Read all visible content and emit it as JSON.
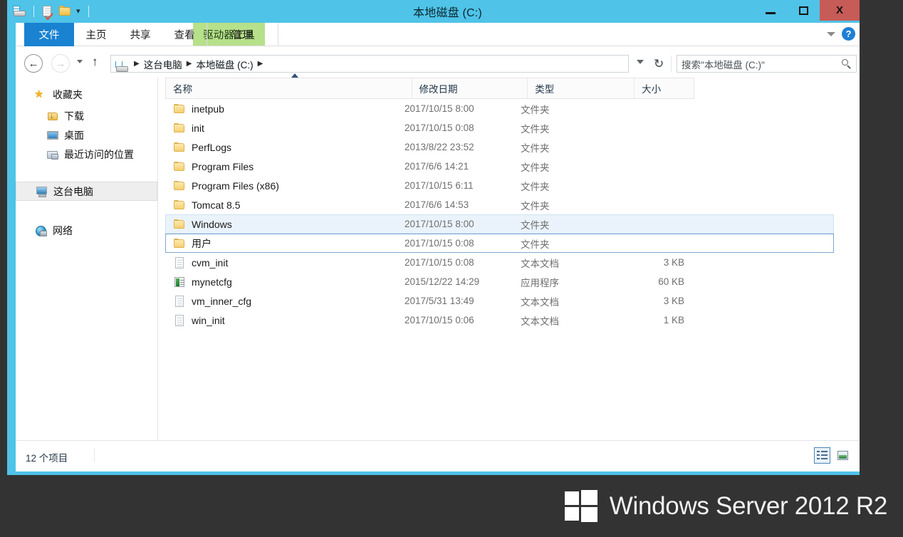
{
  "window": {
    "title": "本地磁盘 (C:)",
    "accent_color": "#4fc3e8",
    "close_color": "#c75b57",
    "quick_access": [
      {
        "name": "drive-icon",
        "label": "本地磁盘 (C:)"
      },
      {
        "name": "properties-icon",
        "label": "属性"
      },
      {
        "name": "new-folder-icon",
        "label": "新建文件夹"
      },
      {
        "name": "customize-qat-caret",
        "label": "▼"
      }
    ],
    "controls": {
      "minimize": "—",
      "maximize": "▢",
      "close": "X"
    }
  },
  "ribbon": {
    "contextual_tab_header": "驱动器工具",
    "contextual_color": "#b6e08a",
    "active_tab_color": "#1982d1",
    "tabs": [
      {
        "label": "文件",
        "active": true
      },
      {
        "label": "主页",
        "active": false
      },
      {
        "label": "共享",
        "active": false
      },
      {
        "label": "查看",
        "active": false
      },
      {
        "label": "管理",
        "active": false,
        "contextual": true
      }
    ],
    "minimize_ribbon_icon": "chevron-down-icon",
    "help_label": "?"
  },
  "navigation": {
    "back_label": "←",
    "forward_label": "→",
    "recent_caret": "▾",
    "up_label": "↑",
    "breadcrumb": [
      {
        "label": "这台电脑"
      },
      {
        "label": "本地磁盘 (C:)"
      }
    ],
    "breadcrumb_separator": "▶",
    "address_dropdown": "▾",
    "refresh_label": "↻"
  },
  "search": {
    "placeholder": "搜索\"本地磁盘 (C:)\"",
    "value": "",
    "icon": "search-icon"
  },
  "sidebar": {
    "items": [
      {
        "label": "收藏夹",
        "icon": "star-icon",
        "level": 0,
        "selected": false
      },
      {
        "label": "下载",
        "icon": "downloads-folder-icon",
        "level": 1,
        "selected": false
      },
      {
        "label": "桌面",
        "icon": "desktop-icon",
        "level": 1,
        "selected": false
      },
      {
        "label": "最近访问的位置",
        "icon": "recent-places-icon",
        "level": 1,
        "selected": false
      },
      {
        "label": "这台电脑",
        "icon": "this-pc-icon",
        "level": 0,
        "selected": true
      },
      {
        "label": "网络",
        "icon": "network-icon",
        "level": 0,
        "selected": false
      }
    ]
  },
  "filelist": {
    "columns": [
      {
        "label": "名称",
        "key": "name",
        "sorted": "asc"
      },
      {
        "label": "修改日期",
        "key": "date"
      },
      {
        "label": "类型",
        "key": "type"
      },
      {
        "label": "大小",
        "key": "size"
      }
    ],
    "sort_indicator": "▲",
    "rows": [
      {
        "name": "inetpub",
        "date": "2017/10/15 8:00",
        "type": "文件夹",
        "size": "",
        "icon": "folder-icon",
        "state": ""
      },
      {
        "name": "init",
        "date": "2017/10/15 0:08",
        "type": "文件夹",
        "size": "",
        "icon": "folder-icon",
        "state": ""
      },
      {
        "name": "PerfLogs",
        "date": "2013/8/22 23:52",
        "type": "文件夹",
        "size": "",
        "icon": "folder-icon",
        "state": ""
      },
      {
        "name": "Program Files",
        "date": "2017/6/6 14:21",
        "type": "文件夹",
        "size": "",
        "icon": "folder-icon",
        "state": ""
      },
      {
        "name": "Program Files (x86)",
        "date": "2017/10/15 6:11",
        "type": "文件夹",
        "size": "",
        "icon": "folder-icon",
        "state": ""
      },
      {
        "name": "Tomcat 8.5",
        "date": "2017/6/6 14:53",
        "type": "文件夹",
        "size": "",
        "icon": "folder-icon",
        "state": ""
      },
      {
        "name": "Windows",
        "date": "2017/10/15 8:00",
        "type": "文件夹",
        "size": "",
        "icon": "folder-icon",
        "state": "highlighted"
      },
      {
        "name": "用户",
        "date": "2017/10/15 0:08",
        "type": "文件夹",
        "size": "",
        "icon": "folder-icon",
        "state": "focused"
      },
      {
        "name": "cvm_init",
        "date": "2017/10/15 0:08",
        "type": "文本文档",
        "size": "3 KB",
        "icon": "text-file-icon",
        "state": ""
      },
      {
        "name": "mynetcfg",
        "date": "2015/12/22 14:29",
        "type": "应用程序",
        "size": "60 KB",
        "icon": "application-icon",
        "state": ""
      },
      {
        "name": "vm_inner_cfg",
        "date": "2017/5/31 13:49",
        "type": "文本文档",
        "size": "3 KB",
        "icon": "text-file-icon",
        "state": ""
      },
      {
        "name": "win_init",
        "date": "2017/10/15 0:06",
        "type": "文本文档",
        "size": "1 KB",
        "icon": "text-file-icon",
        "state": ""
      }
    ]
  },
  "statusbar": {
    "item_count": "12 个项目",
    "views": [
      {
        "name": "details-view-button",
        "label": "详细信息",
        "selected": true
      },
      {
        "name": "large-icons-view-button",
        "label": "大图标",
        "selected": false
      }
    ]
  },
  "desktop": {
    "background_color": "#333333",
    "brand_text": "Windows Server 2012 R2",
    "brand_logo": "windows-logo-icon"
  }
}
